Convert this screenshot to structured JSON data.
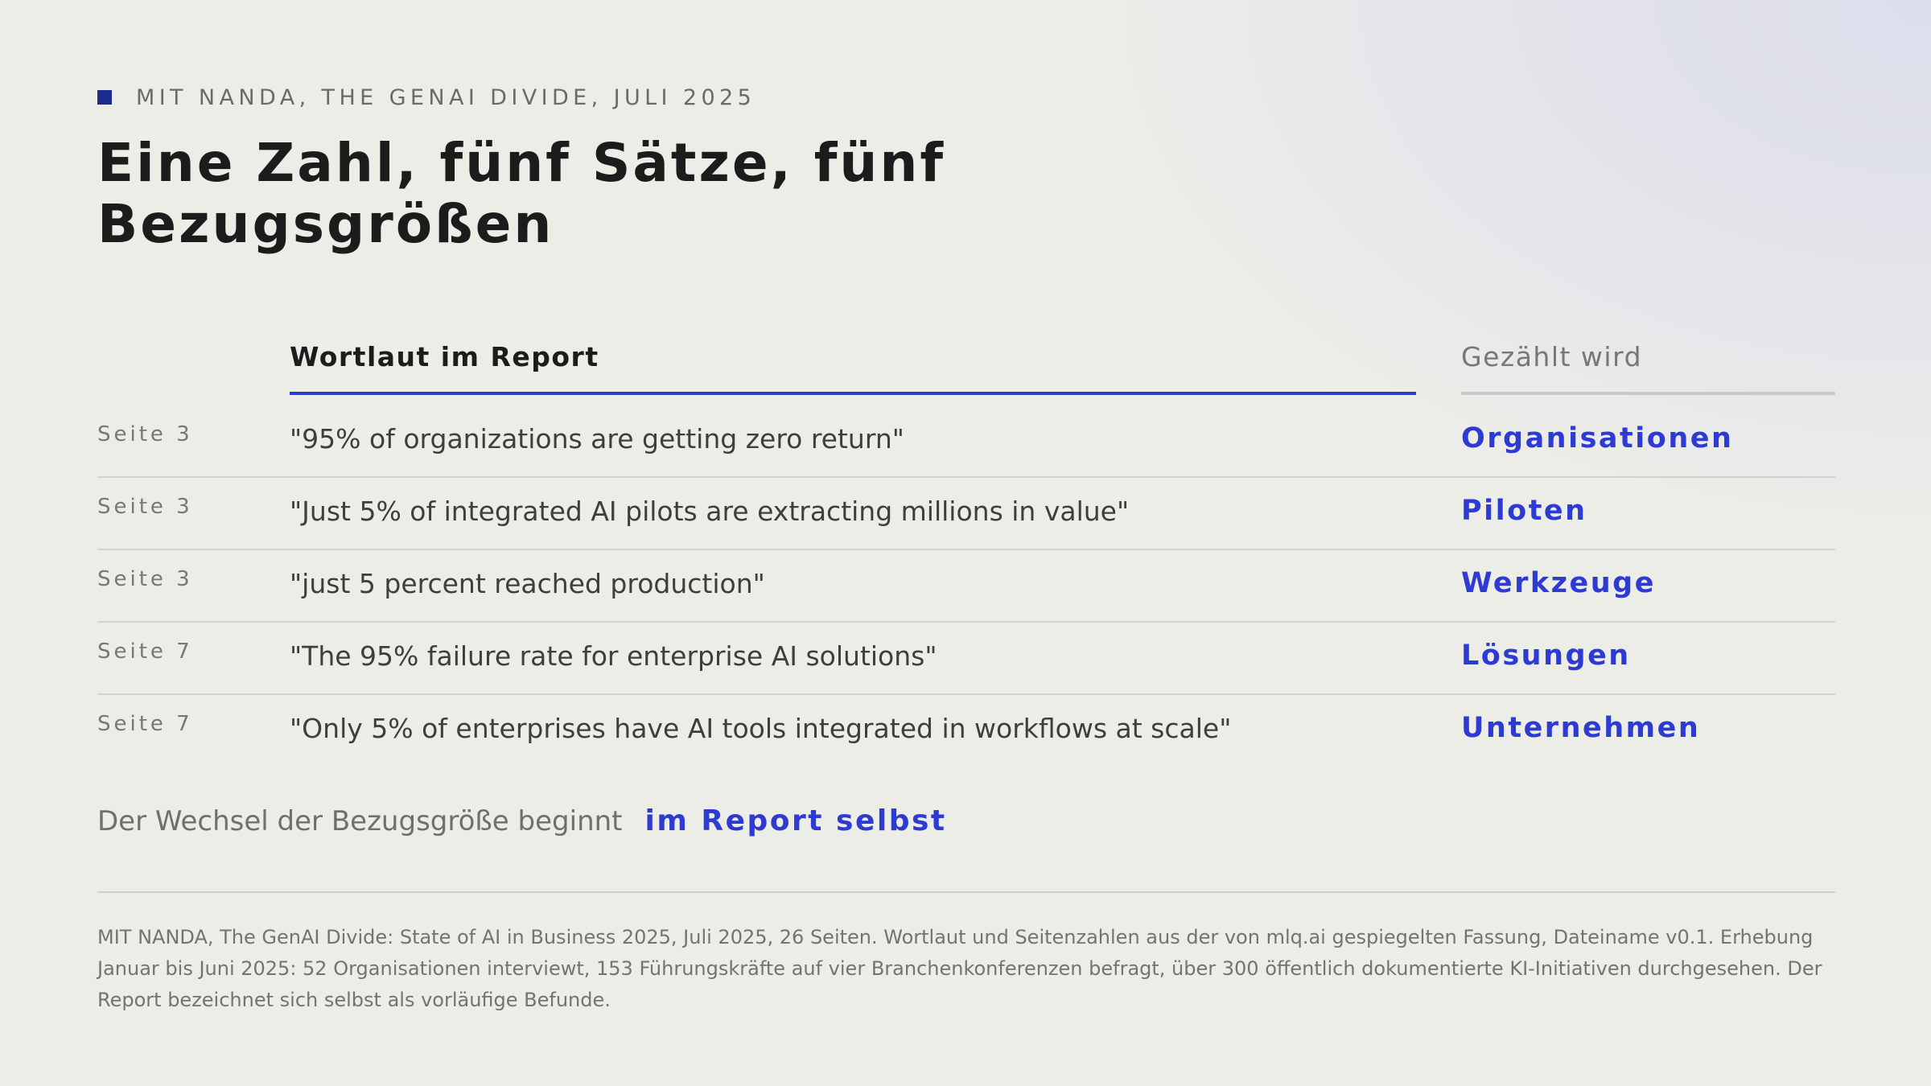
{
  "eyebrow": "MIT NANDA, THE GENAI DIVIDE, JULI 2025",
  "title": "Eine Zahl, fünf Sätze, fünf Bezugsgrößen",
  "columns": {
    "quote": "Wortlaut im Report",
    "counted": "Gezählt wird"
  },
  "rows": [
    {
      "page": "Seite 3",
      "quote": "\"95% of organizations are getting zero return\"",
      "counted": "Organisationen"
    },
    {
      "page": "Seite 3",
      "quote": "\"Just 5% of integrated AI pilots are extracting millions in value\"",
      "counted": "Piloten"
    },
    {
      "page": "Seite 3",
      "quote": "\"just 5 percent reached production\"",
      "counted": "Werkzeuge"
    },
    {
      "page": "Seite 7",
      "quote": "\"The 95% failure rate for enterprise AI solutions\"",
      "counted": "Lösungen"
    },
    {
      "page": "Seite 7",
      "quote": "\"Only 5% of enterprises have AI tools integrated in workflows at scale\"",
      "counted": "Unternehmen"
    }
  ],
  "summary": {
    "lead": "Der Wechsel der Bezugsgröße beginnt",
    "accent": "im Report selbst"
  },
  "footnote": "MIT NANDA, The GenAI Divide: State of AI in Business 2025, Juli 2025, 26 Seiten. Wortlaut und Seitenzahlen aus der von mlq.ai gespiegelten Fassung, Dateiname v0.1. Erhebung Januar bis Juni 2025: 52 Organisationen interviewt, 153 Führungskräfte auf vier Branchenkonferenzen befragt, über 300 öffentlich dokumentierte KI-Initiativen durchgesehen. Der Report bezeichnet sich selbst als vorläufige Befunde.",
  "colors": {
    "accent": "#2e3bd2",
    "eyebrow_square": "#1d2c8c",
    "background": "#edede8"
  }
}
